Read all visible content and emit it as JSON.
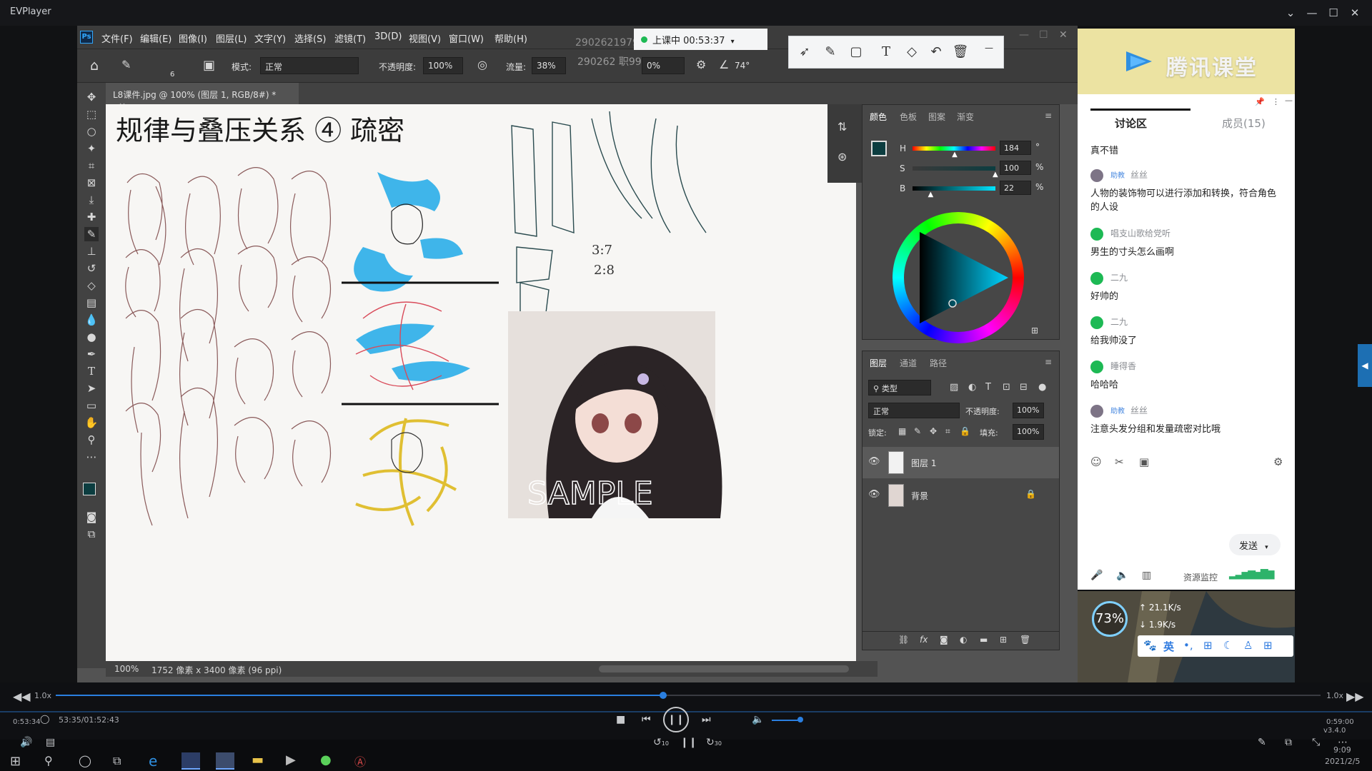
{
  "player": {
    "title": "EVPlayer",
    "speed_left": "1.0x",
    "speed_right": "1.0x",
    "elapsed_small": "0:53:34",
    "time_display": "53:35/01:52:43",
    "time_right": "0:59:00",
    "version": "v3.4.0",
    "progress": 0.48,
    "skip_back": "10",
    "skip_forward": "30"
  },
  "live": {
    "status": "上课中 00:53:37"
  },
  "watermark": {
    "id_1": "2902621979",
    "id_2": "290262 职99"
  },
  "photoshop": {
    "menus": [
      "文件(F)",
      "编辑(E)",
      "图像(I)",
      "图层(L)",
      "文字(Y)",
      "选择(S)",
      "滤镜(T)",
      "3D(D)",
      "视图(V)",
      "窗口(W)",
      "帮助(H)"
    ],
    "options": {
      "brush_size": "6",
      "mode_label": "模式:",
      "mode_value": "正常",
      "opacity_label": "不透明度:",
      "opacity_value": "100%",
      "flow_label": "流量:",
      "flow_value": "38%",
      "smoothing_value": "0%",
      "angle_value": "74°"
    },
    "document_tab": "L8课件.jpg @ 100% (图层 1, RGB/8#) *",
    "status": {
      "zoom": "100%",
      "size": "1752 像素 x 3400 像素 (96 ppi)"
    },
    "artwork": {
      "heading": "规律与叠压关系 ④ 疏密",
      "ratio_1": "3:7",
      "ratio_2": "2:8",
      "sample": "SAMPLE"
    },
    "color_panel": {
      "tabs": [
        "颜色",
        "色板",
        "图案",
        "渐变"
      ],
      "h_label": "H",
      "h_value": "184",
      "h_unit": "°",
      "s_label": "S",
      "s_value": "100",
      "s_unit": "%",
      "b_label": "B",
      "b_value": "22",
      "b_unit": "%",
      "hue_fraction": 0.51,
      "sat_fraction": 1.0,
      "bri_fraction": 0.22,
      "foreground": "#0c3d40"
    },
    "layers_panel": {
      "tabs": [
        "图层",
        "通道",
        "路径"
      ],
      "filter_label": "类型",
      "blend_mode": "正常",
      "opacity_label": "不透明度:",
      "opacity_value": "100%",
      "lock_label": "锁定:",
      "fill_label": "填充:",
      "fill_value": "100%",
      "layers": [
        {
          "name": "图层 1",
          "selected": true
        },
        {
          "name": "背景",
          "locked": true
        }
      ]
    }
  },
  "classroom": {
    "brand": "腾讯课堂",
    "tabs": {
      "discussion": "讨论区",
      "members": "成员(15)"
    },
    "messages": [
      {
        "user": "",
        "text": "真不错"
      },
      {
        "user": "丝丝",
        "tag": "助教",
        "text": "人物的装饰物可以进行添加和转换，符合角色的人设"
      },
      {
        "user": "唱支山歌给党听",
        "text": "男生的寸头怎么画啊"
      },
      {
        "user": "二九",
        "text": "好帅的"
      },
      {
        "user": "二九",
        "text": "给我帅没了"
      },
      {
        "user": "睡得香",
        "text": "哈哈哈"
      },
      {
        "user": "丝丝",
        "tag": "助教",
        "text": "注意头发分组和发量疏密对比哦"
      }
    ],
    "send_button": "发送",
    "resource_monitor": "资源监控",
    "cpu": "73%",
    "net_up": "21.1K/s",
    "net_down": "1.9K/s",
    "ime_label": "英"
  },
  "taskbar": {
    "time": "9:09",
    "date": "2021/2/5"
  }
}
